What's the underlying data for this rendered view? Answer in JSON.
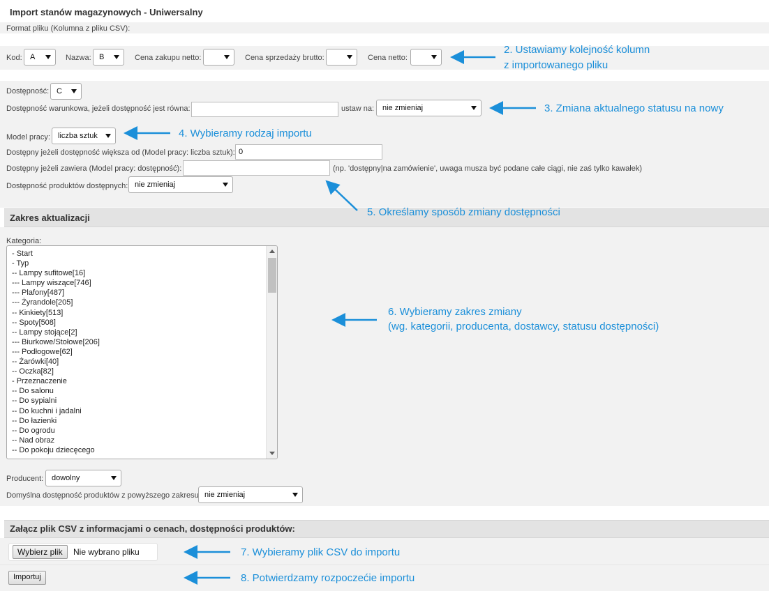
{
  "title": "Import stanów magazynowych - Uniwersalny",
  "format_label": "Format pliku (Kolumna z pliku CSV):",
  "columns": {
    "kod": {
      "label": "Kod:",
      "value": "A"
    },
    "nazwa": {
      "label": "Nazwa:",
      "value": "B"
    },
    "cena_zakupu": {
      "label": "Cena zakupu netto:",
      "value": ""
    },
    "cena_sprzedazy": {
      "label": "Cena sprzedaży brutto:",
      "value": ""
    },
    "cena_netto": {
      "label": "Cena netto:",
      "value": ""
    }
  },
  "availability": {
    "label": "Dostępność:",
    "value": "C",
    "conditional_label": "Dostępność warunkowa, jeżeli dostępność jest równa:",
    "conditional_value": "",
    "set_to_label": "ustaw na:",
    "set_to_value": "nie zmieniaj"
  },
  "work_model": {
    "label": "Model pracy:",
    "value": "liczba sztuk"
  },
  "available_if_greater": {
    "label": "Dostępny jeżeli dostępność większa od (Model pracy: liczba sztuk):",
    "value": "0"
  },
  "available_if_contains": {
    "label": "Dostępny jeżeli zawiera (Model pracy: dostępność):",
    "value": "",
    "hint": "(np. 'dostępny|na zamówienie', uwaga musza być podane całe ciągi, nie zaś tylko kawałek)"
  },
  "available_products": {
    "label": "Dostępność produktów dostępnych:",
    "value": "nie zmieniaj"
  },
  "scope": {
    "header": "Zakres aktualizacji",
    "category_label": "Kategoria:",
    "categories": [
      "- Start",
      "- Typ",
      "-- Lampy sufitowe[16]",
      "--- Lampy wiszące[746]",
      "--- Plafony[487]",
      "--- Żyrandole[205]",
      "-- Kinkiety[513]",
      "-- Spoty[508]",
      "-- Lampy stojące[2]",
      "--- Biurkowe/Stołowe[206]",
      "--- Podłogowe[62]",
      "-- Żarówki[40]",
      "-- Oczka[82]",
      "- Przeznaczenie",
      "-- Do salonu",
      "-- Do sypialni",
      "-- Do kuchni i jadalni",
      "-- Do łazienki",
      "-- Do ogrodu",
      "-- Nad obraz",
      "-- Do pokoju dziecęcego"
    ],
    "producer_label": "Producent:",
    "producer_value": "dowolny",
    "default_avail_label": "Domyślna dostępność produktów z powyższego zakresu:",
    "default_avail_value": "nie zmieniaj"
  },
  "attach": {
    "header": "Załącz plik CSV z informacjami o cenach, dostępności produktów:",
    "choose_button": "Wybierz plik",
    "no_file": "Nie wybrano pliku",
    "import_button": "Importuj"
  },
  "annotations": {
    "a2_line1": "2. Ustawiamy kolejność kolumn",
    "a2_line2": "z importowanego pliku",
    "a3": "3. Zmiana aktualnego statusu na nowy",
    "a4": "4. Wybieramy rodzaj importu",
    "a5": "5. Określamy sposób zmiany dostępności",
    "a6_line1": "6. Wybieramy zakres zmiany",
    "a6_line2": "(wg. kategorii, producenta, dostawcy, statusu dostępności)",
    "a7": "7. Wybieramy plik CSV do importu",
    "a8": "8. Potwierdzamy rozpoczećie importu"
  },
  "colors": {
    "annotation": "#1b8fd9",
    "header_bg": "#e3e3e3",
    "band_bg": "#f2f2f2"
  }
}
